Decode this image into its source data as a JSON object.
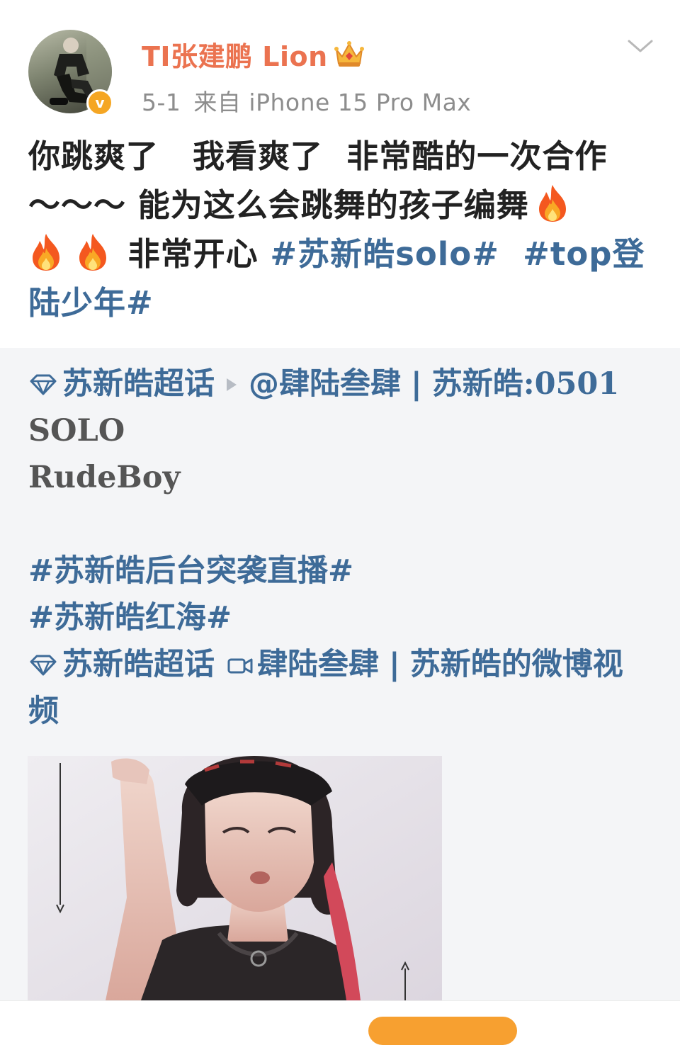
{
  "header": {
    "username": "TI张建鹏 Lion",
    "date": "5-1",
    "source": "来自 iPhone 15 Pro Max",
    "verified_mark": "v",
    "icons": {
      "avatar": "user-avatar",
      "badge": "verified-badge-icon",
      "crown": "crown-icon",
      "menu": "chevron-down-icon"
    }
  },
  "post": {
    "text_1": "你跳爽了",
    "text_2": "我看爽了",
    "text_3": "非常酷的一次合作",
    "text_4": "～～～",
    "text_5": "能为这么会跳舞的孩子编舞",
    "text_6": "非常开心",
    "topic_1": "#苏新皓solo#",
    "topic_2": "#top登陆少年#",
    "emoji": "fire-emoji"
  },
  "repost": {
    "supertopic_1": "苏新皓超话",
    "mention": "@肆陆叁肆",
    "separator": "|",
    "title_prefix": "苏新皓",
    "title_suffix": ":0501",
    "line_solo": "SOLO",
    "line_rudeboy": "RudeBoy",
    "topic_backstage": "#苏新皓后台突袭直播#",
    "topic_redsea": "#苏新皓红海#",
    "supertopic_2": "苏新皓超话",
    "video_source": "肆陆叁肆",
    "video_title": "苏新皓的微博视频"
  },
  "colors": {
    "username": "#eb7350",
    "link": "#3e6b98",
    "meta": "#8d8d8d",
    "repost_bg": "#f4f5f7",
    "badge": "#f5a623"
  }
}
